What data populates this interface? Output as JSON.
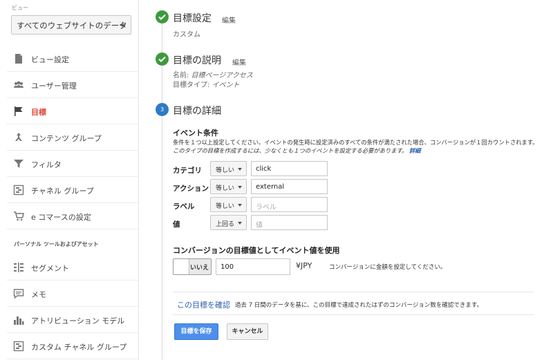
{
  "sidebar": {
    "view_label": "ビュー",
    "view_select": "すべてのウェブサイトのデータ",
    "items": [
      {
        "label": "ビュー設定",
        "icon": "document-icon"
      },
      {
        "label": "ユーザー管理",
        "icon": "users-icon"
      },
      {
        "label": "目標",
        "icon": "flag-icon",
        "active": true
      },
      {
        "label": "コンテンツ グループ",
        "icon": "content-group-icon"
      },
      {
        "label": "フィルタ",
        "icon": "filter-icon"
      },
      {
        "label": "チャネル グループ",
        "icon": "channel-group-icon"
      },
      {
        "label": "e コマースの設定",
        "icon": "cart-icon"
      }
    ],
    "section_title": "パーソナル ツールおよびアセット",
    "items2": [
      {
        "label": "セグメント",
        "icon": "segment-icon"
      },
      {
        "label": "メモ",
        "icon": "note-icon"
      },
      {
        "label": "アトリビューション モデル",
        "icon": "bar-chart-icon"
      },
      {
        "label": "カスタム チャネル グループ",
        "icon": "channel-group-icon"
      }
    ]
  },
  "steps": {
    "s1": {
      "title": "目標設定",
      "edit": "編集",
      "sub": "カスタム"
    },
    "s2": {
      "title": "目標の説明",
      "edit": "編集",
      "name_label": "名前:",
      "name_value": "目標ページアクセス",
      "type_label": "目標タイプ:",
      "type_value": "イベント"
    },
    "s3": {
      "title": "目標の詳細",
      "number": "3"
    }
  },
  "details": {
    "heading": "イベント条件",
    "desc1": "条件を１つ以上設定してください。イベントの発生時に設定済みのすべての条件が満たされた場合、コンバージョンが１回カウントされます。",
    "desc2": "このタイプの目標を作成するには、少なくとも１つのイベントを設定する必要があります。",
    "detail_link": "詳細",
    "conditions": [
      {
        "label": "カテゴリ",
        "op": "等しい",
        "value": "click",
        "placeholder": ""
      },
      {
        "label": "アクション",
        "op": "等しい",
        "value": "external",
        "placeholder": ""
      },
      {
        "label": "ラベル",
        "op": "等しい",
        "value": "",
        "placeholder": "ラベル"
      },
      {
        "label": "値",
        "op": "上回る",
        "value": "",
        "placeholder": "値"
      }
    ],
    "value_heading": "コンバージョンの目標値としてイベント値を使用",
    "toggle_label": "いいえ",
    "amount": "100",
    "currency": "¥JPY",
    "amount_note": "コンバージョンに金額を設定してください。",
    "verify_link": "この目標を確認",
    "verify_note": "過去 7 日間のデータを基に、この目標で達成されたはずのコンバージョン数を確認できます。",
    "save": "目標を保存",
    "cancel": "キャンセル"
  }
}
